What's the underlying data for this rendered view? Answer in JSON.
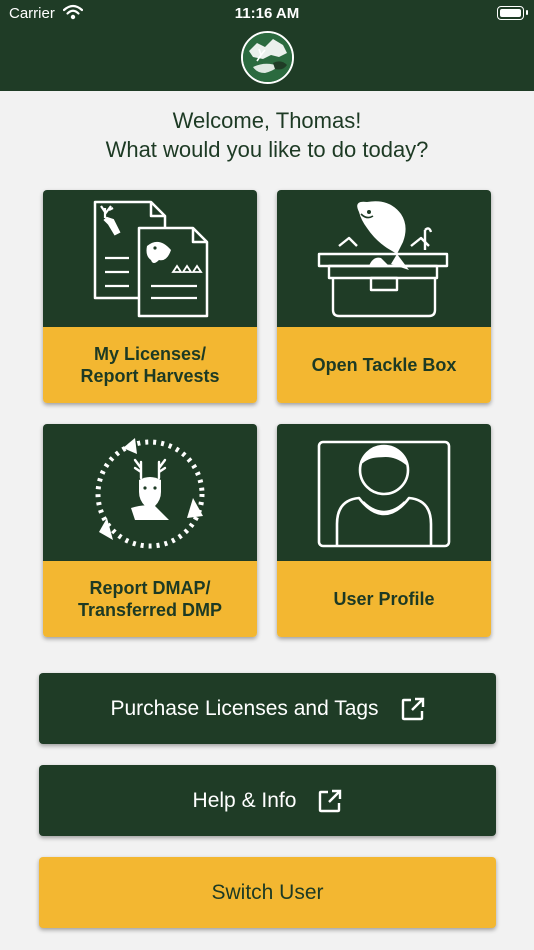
{
  "status_bar": {
    "carrier": "Carrier",
    "time": "11:16 AM"
  },
  "header": {
    "logo_icon": "nys-dec-emblem-icon",
    "colors": {
      "bar": "#1f3c26",
      "accent": "#f3b731"
    }
  },
  "greeting": {
    "line1": "Welcome, Thomas!",
    "line2": "What would you like to do today?"
  },
  "tiles": [
    {
      "line1": "My Licenses/",
      "line2": "Report Harvests",
      "icon": "license-documents-icon"
    },
    {
      "line1": "Open Tackle Box",
      "line2": "",
      "icon": "tackle-box-fish-icon"
    },
    {
      "line1": "Report DMAP/",
      "line2": "Transferred DMP",
      "icon": "deer-transfer-cycle-icon"
    },
    {
      "line1": "User Profile",
      "line2": "",
      "icon": "user-profile-icon"
    }
  ],
  "buttons": {
    "purchase": "Purchase Licenses and Tags",
    "help": "Help & Info",
    "switch_user": "Switch User"
  }
}
